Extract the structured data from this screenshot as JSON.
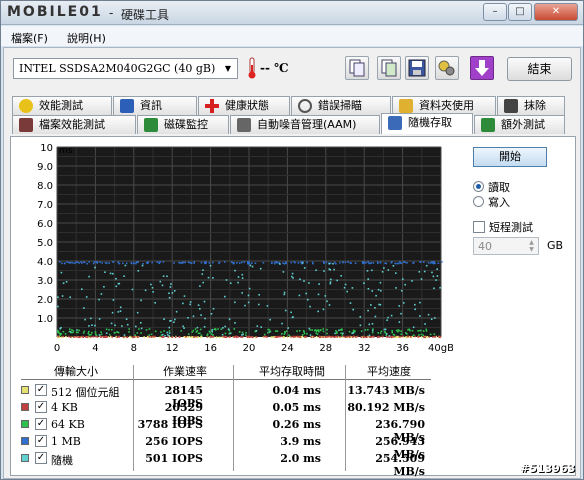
{
  "window": {
    "logo_text": "MOBILE01",
    "separator": "-",
    "title": "硬碟工具",
    "min_label": "–",
    "max_label": "□",
    "close_label": "✕"
  },
  "menu": [
    {
      "label": "檔案(F)"
    },
    {
      "label": "說明(H)"
    }
  ],
  "toolbar": {
    "drive": "INTEL SSDSA2M040G2GC (40 gB)",
    "temperature": "-- ℃",
    "exit_label": "結束"
  },
  "tabs_row1": [
    {
      "label": "效能測試",
      "icon": "lightbulb-icon",
      "color": "#e8c21a"
    },
    {
      "label": "資訊",
      "icon": "info-icon",
      "color": "#2b5fb8"
    },
    {
      "label": "健康狀態",
      "icon": "health-cross-icon",
      "color": "#d62020"
    },
    {
      "label": "錯誤掃瞄",
      "icon": "magnifier-icon",
      "color": "#555555"
    },
    {
      "label": "資料夾使用",
      "icon": "folder-icon",
      "color": "#e0b030"
    },
    {
      "label": "抹除",
      "icon": "trash-icon",
      "color": "#444444"
    }
  ],
  "tabs_row2": [
    {
      "label": "檔案效能測試",
      "icon": "file-benchmark-icon",
      "color": "#7a3a3a"
    },
    {
      "label": "磁碟監控",
      "icon": "monitor-chart-icon",
      "color": "#2e8b3a"
    },
    {
      "label": "自動噪音管理(AAM)",
      "icon": "speaker-icon",
      "color": "#666666"
    },
    {
      "label": "隨機存取",
      "icon": "random-access-icon",
      "color": "#3a6ab8"
    },
    {
      "label": "額外測試",
      "icon": "extra-test-icon",
      "color": "#2e8b3a"
    }
  ],
  "controls": {
    "start_label": "開始",
    "read_label": "讀取",
    "write_label": "寫入",
    "short_test_label": "短程測試",
    "size_value": "40",
    "size_unit": "GB"
  },
  "chart_data": {
    "type": "scatter",
    "y_unit": "ms",
    "x_unit": "gB",
    "x_ticks": [
      "0",
      "4",
      "8",
      "12",
      "16",
      "20",
      "24",
      "28",
      "32",
      "36",
      "40gB"
    ],
    "y_ticks": [
      "1.0",
      "2.0",
      "3.0",
      "4.0",
      "5.0",
      "6.0",
      "7.0",
      "8.0",
      "9.0",
      "10"
    ],
    "xlim": [
      0,
      40
    ],
    "ylim": [
      0,
      10
    ],
    "grid": true,
    "background": "#1a1a1a",
    "series": [
      {
        "name": "512 個位元組",
        "color": "#e6e070",
        "y_center": 0.04,
        "spread": 0.05
      },
      {
        "name": "4 KB",
        "color": "#c04040",
        "y_center": 0.05,
        "spread": 0.05
      },
      {
        "name": "64 KB",
        "color": "#30c050",
        "y_center": 0.3,
        "spread": 0.35
      },
      {
        "name": "1 MB",
        "color": "#3070d0",
        "y_center": 3.95,
        "spread": 0.1
      },
      {
        "name": "隨機",
        "color": "#60d0d0",
        "y_center": 2.0,
        "spread": 1.9
      }
    ]
  },
  "results": {
    "headers": [
      "傳輸大小",
      "作業速率",
      "平均存取時間",
      "平均速度"
    ],
    "rows": [
      {
        "label": "512 個位元組",
        "iops": "28145 IOPS",
        "access": "0.04 ms",
        "speed": "13.743 MB/s",
        "color": "#e6e070",
        "checked": "✓"
      },
      {
        "label": "4 KB",
        "iops": "20529 IOPS",
        "access": "0.05 ms",
        "speed": "80.192 MB/s",
        "color": "#c04040",
        "checked": "✓"
      },
      {
        "label": "64 KB",
        "iops": "3788 IOPS",
        "access": "0.26 ms",
        "speed": "236.790 MB/s",
        "color": "#30c050",
        "checked": "✓"
      },
      {
        "label": "1 MB",
        "iops": "256 IOPS",
        "access": "3.9 ms",
        "speed": "256.943 MB/s",
        "color": "#3070d0",
        "checked": "✓"
      },
      {
        "label": "隨機",
        "iops": "501 IOPS",
        "access": "2.0 ms",
        "speed": "254.509 MB/s",
        "color": "#60d0d0",
        "checked": "✓"
      }
    ]
  },
  "watermark": "#513963"
}
